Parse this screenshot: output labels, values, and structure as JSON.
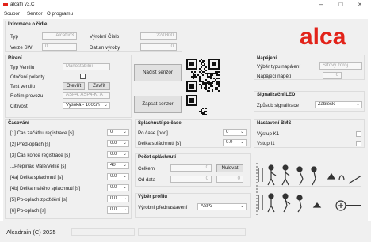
{
  "window": {
    "title": "alcaffi v3.C",
    "minimize": "–",
    "maximize": "□",
    "close": "×"
  },
  "menu": [
    "Soubor",
    "Senzor",
    "O programu"
  ],
  "info": {
    "title": "Informace o čidle",
    "typ_label": "Typ",
    "typ_value": "Alcaffic3",
    "vyrobni_label": "Výrobní Číslo",
    "vyrobni_value": "22/0300",
    "verze_label": "Verze SW",
    "verze_value": "0",
    "datum_label": "Datum výroby",
    "datum_value": "0"
  },
  "logo": "alca",
  "rizeni": {
    "title": "Řízení",
    "typ_ventilu_label": "Typ Ventilu",
    "typ_ventilu_value": "Manostabilní",
    "otoceni_label": "Otočení polarity",
    "test_label": "Test ventilu",
    "open_btn": "Otevřít",
    "close_btn": "Zavřít",
    "rezim_label": "Režim provozu",
    "rezim_value": "ASP4, ASP4-K, A",
    "citlivost_label": "Citlivost",
    "citlivost_value": "Vysoká - 100cm"
  },
  "center": {
    "read_btn": "Načíst senzor",
    "write_btn": "Zapsat senzor"
  },
  "napajeni": {
    "title": "Napájení",
    "vyber_label": "Výběr typu napájení",
    "vyber_value": "Síťový zdroj",
    "napeti_label": "Napájecí napětí",
    "napeti_value": "0"
  },
  "led": {
    "title": "Signalizační LED",
    "zpusob_label": "Způsob signalizace",
    "zpusob_value": "Záblesk"
  },
  "bms": {
    "title": "Nastavení BMS",
    "k1_label": "Výstup K1",
    "i1_label": "Vstup I1"
  },
  "casovani": {
    "title": "Časování",
    "rows": [
      {
        "label": "[1] Čas začátku registrace [s]",
        "value": "0"
      },
      {
        "label": "[2] Před-oplach [s]",
        "value": "0.0"
      },
      {
        "label": "[3] Čas konce registrace [s]",
        "value": "0.0"
      },
      {
        "label": "...Přepínač Malé/Velké [s]",
        "value": "40"
      },
      {
        "label": "[4a] Délka splachnutí [s]",
        "value": "0.0"
      },
      {
        "label": "[4b] Délka malého splachnutí [s]",
        "value": "0.0"
      },
      {
        "label": "[5] Po-oplach zpoždění [s]",
        "value": "0.0"
      },
      {
        "label": "[6] Po-oplach [s]",
        "value": "0.0"
      }
    ]
  },
  "splachnuti": {
    "title": "Spláchnutí po čase",
    "po_case_label": "Po čase [hod]",
    "po_case_value": "0",
    "delka_label": "Délka spláchnutí [s]",
    "delka_value": "0.0"
  },
  "pocet": {
    "title": "Počet spláchnutí",
    "celkem_label": "Celkem",
    "celkem_value": "0",
    "nulovat_btn": "Nulovat",
    "od_data_label": "Od data",
    "od_data_value": "0",
    "od_data_value2": "0"
  },
  "profil": {
    "title": "Výběr profilu",
    "vyrobni_label": "Výrobní přednastavení",
    "vyrobni_value": "ASP3"
  },
  "status": {
    "text": "Alcadrain",
    "copyright": "(C) 2025"
  }
}
